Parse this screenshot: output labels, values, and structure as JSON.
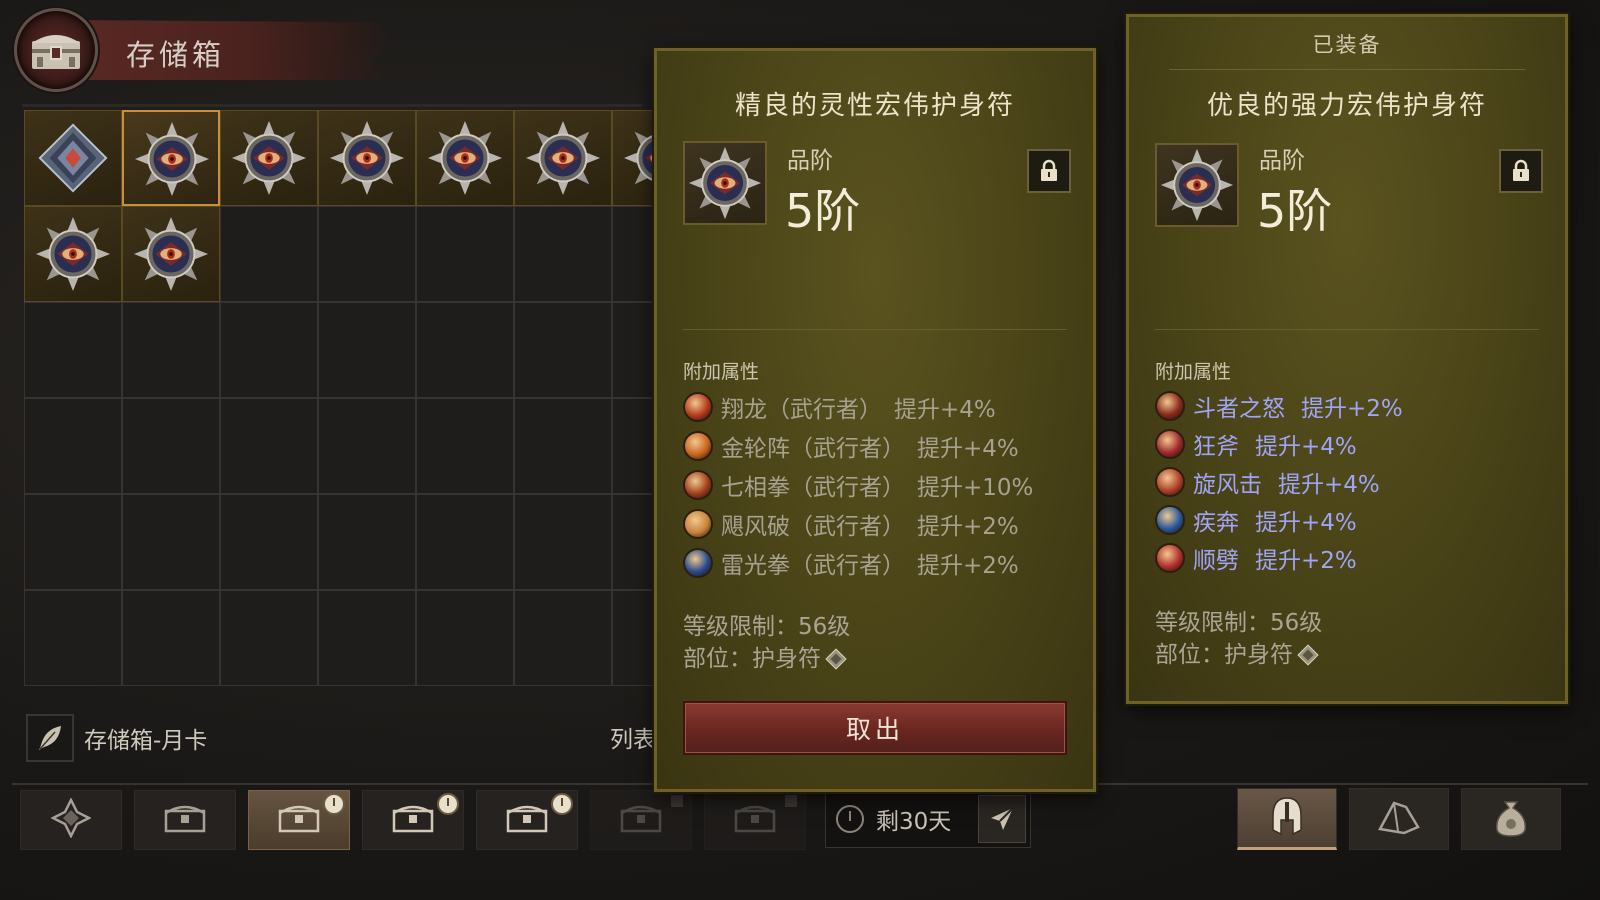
{
  "stash": {
    "title": "存储箱",
    "monthly_label": "存储箱-月卡",
    "list_label": "列表",
    "days_remaining": "剩30天"
  },
  "grid": {
    "columns": 7,
    "rows": 6,
    "items": [
      {
        "type": "gem",
        "selected": false
      },
      {
        "type": "amulet",
        "selected": true
      },
      {
        "type": "amulet",
        "selected": false
      },
      {
        "type": "amulet",
        "selected": false
      },
      {
        "type": "amulet",
        "selected": false
      },
      {
        "type": "amulet",
        "selected": false
      },
      {
        "type": "amulet",
        "selected": false
      },
      {
        "type": "amulet",
        "selected": false
      },
      {
        "type": "amulet",
        "selected": false
      }
    ]
  },
  "selected_item": {
    "name": "精良的灵性宏伟护身符",
    "grade_label": "品阶",
    "grade_value": "5阶",
    "affix_header": "附加属性",
    "affixes": [
      {
        "name": "翔龙（武行者）",
        "bonus": "提升+4%",
        "icon": "dragon-skill-icon",
        "color": "#b33a1c"
      },
      {
        "name": "金轮阵（武行者）",
        "bonus": "提升+4%",
        "icon": "golden-wheel-skill-icon",
        "color": "#c8641c"
      },
      {
        "name": "七相拳（武行者）",
        "bonus": "提升+10%",
        "icon": "seven-fists-skill-icon",
        "color": "#a0401c"
      },
      {
        "name": "飓风破（武行者）",
        "bonus": "提升+2%",
        "icon": "hurricane-skill-icon",
        "color": "#c8823a"
      },
      {
        "name": "雷光拳（武行者）",
        "bonus": "提升+2%",
        "icon": "thunder-fist-skill-icon",
        "color": "#2a4a8a"
      }
    ],
    "level_req": "等级限制：56级",
    "slot": "部位：护身符",
    "take_out_label": "取出"
  },
  "equipped_item": {
    "header": "已装备",
    "name": "优良的强力宏伟护身符",
    "grade_label": "品阶",
    "grade_value": "5阶",
    "affix_header": "附加属性",
    "affixes": [
      {
        "name": "斗者之怒",
        "bonus": "提升+2%",
        "icon": "fighters-fury-skill-icon",
        "color": "#8a2a1c"
      },
      {
        "name": "狂斧",
        "bonus": "提升+4%",
        "icon": "frenzy-axe-skill-icon",
        "color": "#a02a2a"
      },
      {
        "name": "旋风击",
        "bonus": "提升+4%",
        "icon": "whirlwind-skill-icon",
        "color": "#b0402a"
      },
      {
        "name": "疾奔",
        "bonus": "提升+4%",
        "icon": "sprint-skill-icon",
        "color": "#2a5a9a"
      },
      {
        "name": "顺劈",
        "bonus": "提升+2%",
        "icon": "cleave-skill-icon",
        "color": "#b0302a"
      }
    ],
    "level_req": "等级限制：56级",
    "slot": "部位：护身符"
  },
  "bottom_tabs": [
    {
      "icon": "compass-icon",
      "state": "normal",
      "timer": false
    },
    {
      "icon": "chest-icon",
      "state": "normal",
      "timer": false
    },
    {
      "icon": "chest-timed-icon",
      "state": "active",
      "timer": true
    },
    {
      "icon": "chest-timed-icon",
      "state": "normal",
      "timer": true
    },
    {
      "icon": "chest-timed-icon",
      "state": "normal",
      "timer": true
    },
    {
      "icon": "chest-locked-icon",
      "state": "dim",
      "timer": false
    },
    {
      "icon": "chest-locked-icon",
      "state": "dim",
      "timer": false
    }
  ],
  "right_tabs": [
    {
      "icon": "helmet-icon",
      "state": "active"
    },
    {
      "icon": "shard-icon",
      "state": "normal"
    },
    {
      "icon": "gold-bag-icon",
      "state": "normal"
    }
  ],
  "colors": {
    "tooltip_bg": "#4a4418",
    "selected_border": "#c98f3c",
    "affix_blue": "#a0a4f4",
    "button_red": "#6a2620"
  }
}
